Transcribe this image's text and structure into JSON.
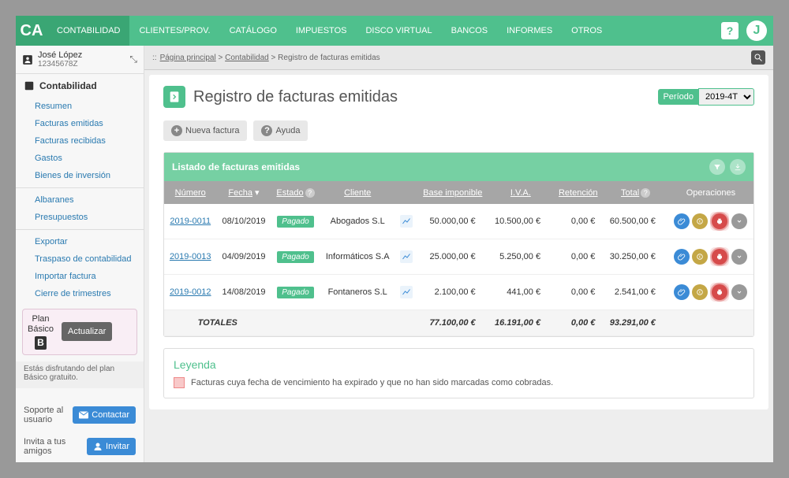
{
  "brand": "CA",
  "avatar_initial": "J",
  "nav": {
    "items": [
      "CONTABILIDAD",
      "CLIENTES/PROV.",
      "CATÁLOGO",
      "IMPUESTOS",
      "DISCO VIRTUAL",
      "BANCOS",
      "INFORMES",
      "OTROS"
    ],
    "active_index": 0
  },
  "user": {
    "name": "José López",
    "id": "12345678Z"
  },
  "sidebar": {
    "section_title": "Contabilidad",
    "group1": [
      "Resumen",
      "Facturas emitidas",
      "Facturas recibidas",
      "Gastos",
      "Bienes de inversión"
    ],
    "group2": [
      "Albaranes",
      "Presupuestos"
    ],
    "group3": [
      "Exportar",
      "Traspaso de contabilidad",
      "Importar factura",
      "Cierre de trimestres"
    ],
    "plan": {
      "line1": "Plan",
      "line2": "Básico",
      "badge": "B",
      "button": "Actualizar",
      "note": "Estás disfrutando del plan Básico gratuito."
    },
    "support": {
      "label": "Soporte al usuario",
      "button": "Contactar"
    },
    "invite": {
      "label": "Invita a tus amigos",
      "button": "Invitar"
    }
  },
  "breadcrumb": {
    "home": "Página principal",
    "section": "Contabilidad",
    "current": "Registro de facturas emitidas"
  },
  "page": {
    "title": "Registro de facturas emitidas",
    "period_label": "Período",
    "period_value": "2019-4T",
    "new_invoice": "Nueva factura",
    "help": "Ayuda"
  },
  "table": {
    "title": "Listado de facturas emitidas",
    "headers": {
      "numero": "Número",
      "fecha": "Fecha",
      "estado": "Estado",
      "cliente": "Cliente",
      "base": "Base imponible",
      "iva": "I.V.A.",
      "retencion": "Retención",
      "total": "Total",
      "ops": "Operaciones"
    },
    "rows": [
      {
        "numero": "2019-0011",
        "fecha": "08/10/2019",
        "estado": "Pagado",
        "cliente": "Abogados S.L",
        "base": "50.000,00 €",
        "iva": "10.500,00 €",
        "retencion": "0,00 €",
        "total": "60.500,00 €"
      },
      {
        "numero": "2019-0013",
        "fecha": "04/09/2019",
        "estado": "Pagado",
        "cliente": "Informáticos S.A",
        "base": "25.000,00 €",
        "iva": "5.250,00 €",
        "retencion": "0,00 €",
        "total": "30.250,00 €"
      },
      {
        "numero": "2019-0012",
        "fecha": "14/08/2019",
        "estado": "Pagado",
        "cliente": "Fontaneros S.L",
        "base": "2.100,00 €",
        "iva": "441,00 €",
        "retencion": "0,00 €",
        "total": "2.541,00 €"
      }
    ],
    "totals": {
      "label": "TOTALES",
      "base": "77.100,00 €",
      "iva": "16.191,00 €",
      "retencion": "0,00 €",
      "total": "93.291,00 €"
    }
  },
  "legend": {
    "title": "Leyenda",
    "text": "Facturas cuya fecha de vencimiento ha expirado y que no han sido marcadas como cobradas."
  }
}
